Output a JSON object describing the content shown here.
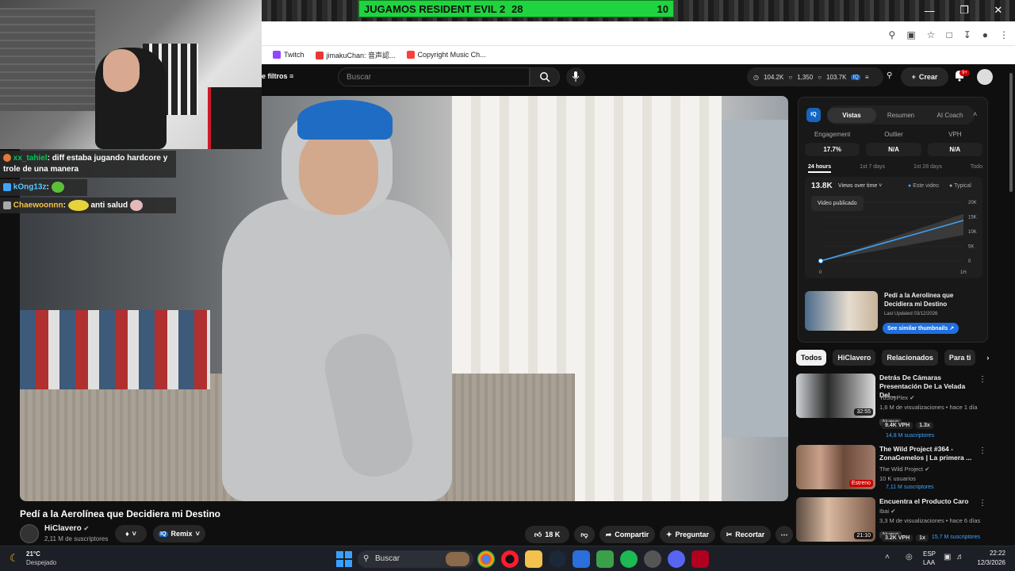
{
  "overlay": {
    "scoreboard_title": "JUGAMOS RESIDENT EVIL 2",
    "score_left": "28",
    "score_right": "10"
  },
  "window_controls": {
    "minimize": "—",
    "maximize": "❐",
    "close": "✕"
  },
  "bookmarks": [
    {
      "label": "Twitch",
      "color": "#9146ff"
    },
    {
      "label": "jimakuChan: 音声認...",
      "color": "#e53935"
    },
    {
      "label": "Copyright Music Ch...",
      "color": "#ff3d3d"
    }
  ],
  "youtube_header": {
    "filters_label": "e filtros",
    "search_placeholder": "Buscar",
    "stats": [
      "104.2K",
      "1,350",
      "103.7K"
    ],
    "create_label": "Crear",
    "notifications_badge": "9+"
  },
  "chat": [
    {
      "user": "xx_tahiel",
      "text": ": diff estaba jugando hardcore y trole de una manera"
    },
    {
      "user": "kOng13z",
      "text": ":"
    },
    {
      "user": "Chaewoonnn",
      "text": ":",
      "after": "anti salud"
    }
  ],
  "video": {
    "title": "Pedí a la Aerolínea que Decidiera mi Destino",
    "channel": "HiClavero",
    "subscribers": "2,11 M de suscriptores",
    "remix_label": "Remix",
    "likes": "18 K",
    "share_label": "Compartir",
    "ask_label": "Preguntar",
    "clip_label": "Recortar"
  },
  "analytics": {
    "tabs": [
      "Vistas",
      "Resumen",
      "AI Coach"
    ],
    "metrics": [
      {
        "label": "Engagement",
        "value": "17.7%"
      },
      {
        "label": "Outlier",
        "value": "N/A"
      },
      {
        "label": "VPH",
        "value": "N/A"
      }
    ],
    "ranges": [
      "24 hours",
      "1st 7 days",
      "1st 28 days",
      "Todo"
    ],
    "views": "13.8K",
    "views_mode": "Views over time",
    "legend_this": "Este video",
    "legend_typical": "Typical",
    "tooltip": "Video publicado",
    "y_ticks": [
      "20K",
      "15K",
      "10K",
      "5K",
      "0"
    ],
    "x_ticks": [
      "0",
      "1H"
    ],
    "thumb_title": "Pedí a la Aerolínea que Decidiera mi Destino",
    "last_updated": "Last Updated 03/12/2026",
    "similar_button": "See similar thumbnails"
  },
  "chart_data": {
    "type": "line",
    "xlabel": "",
    "ylabel": "",
    "ylim": [
      0,
      20000
    ],
    "x_range": [
      "0",
      "1H"
    ],
    "series": [
      {
        "name": "Este video",
        "x": [
          0,
          1
        ],
        "values": [
          0,
          13800
        ],
        "color": "#3ea6ff"
      },
      {
        "name": "Typical",
        "x": [
          0,
          1
        ],
        "values": [
          0,
          16000
        ],
        "color": "#777777"
      }
    ]
  },
  "chips": [
    "Todos",
    "HiClavero",
    "Relacionados",
    "Para ti"
  ],
  "related": [
    {
      "title": "Detrás De Cámaras Presentación De La Velada Del...",
      "channel": "YoSoyPlex",
      "meta": "1,6 M de visualizaciones • hace 1 día",
      "badge": "Nuevo",
      "vph": "9.4K VPH",
      "multiplier": "1.3x",
      "subs": "14,8 M suscriptores",
      "duration": "32:55"
    },
    {
      "title": "The Wild Project #364 - ZonaGemelos | La primera ...",
      "channel": "The Wild Project",
      "meta": "10 K usuarios",
      "badge": "",
      "vph": "",
      "multiplier": "",
      "subs": "7,11 M suscriptores",
      "duration": "Estreno"
    },
    {
      "title": "Encuentra el Producto Caro",
      "channel": "Ibai",
      "meta": "3,3 M de visualizaciones • hace 6 días",
      "badge": "Nuevo",
      "vph": "3.2K VPH",
      "multiplier": "1x",
      "subs": "15,7 M suscriptores",
      "duration": "21:10"
    }
  ],
  "taskbar": {
    "weather_temp": "21°C",
    "weather_desc": "Despejado",
    "search_label": "Buscar",
    "lang_top": "ESP",
    "lang_bottom": "LAA",
    "time": "22:22",
    "date": "12/3/2026"
  }
}
